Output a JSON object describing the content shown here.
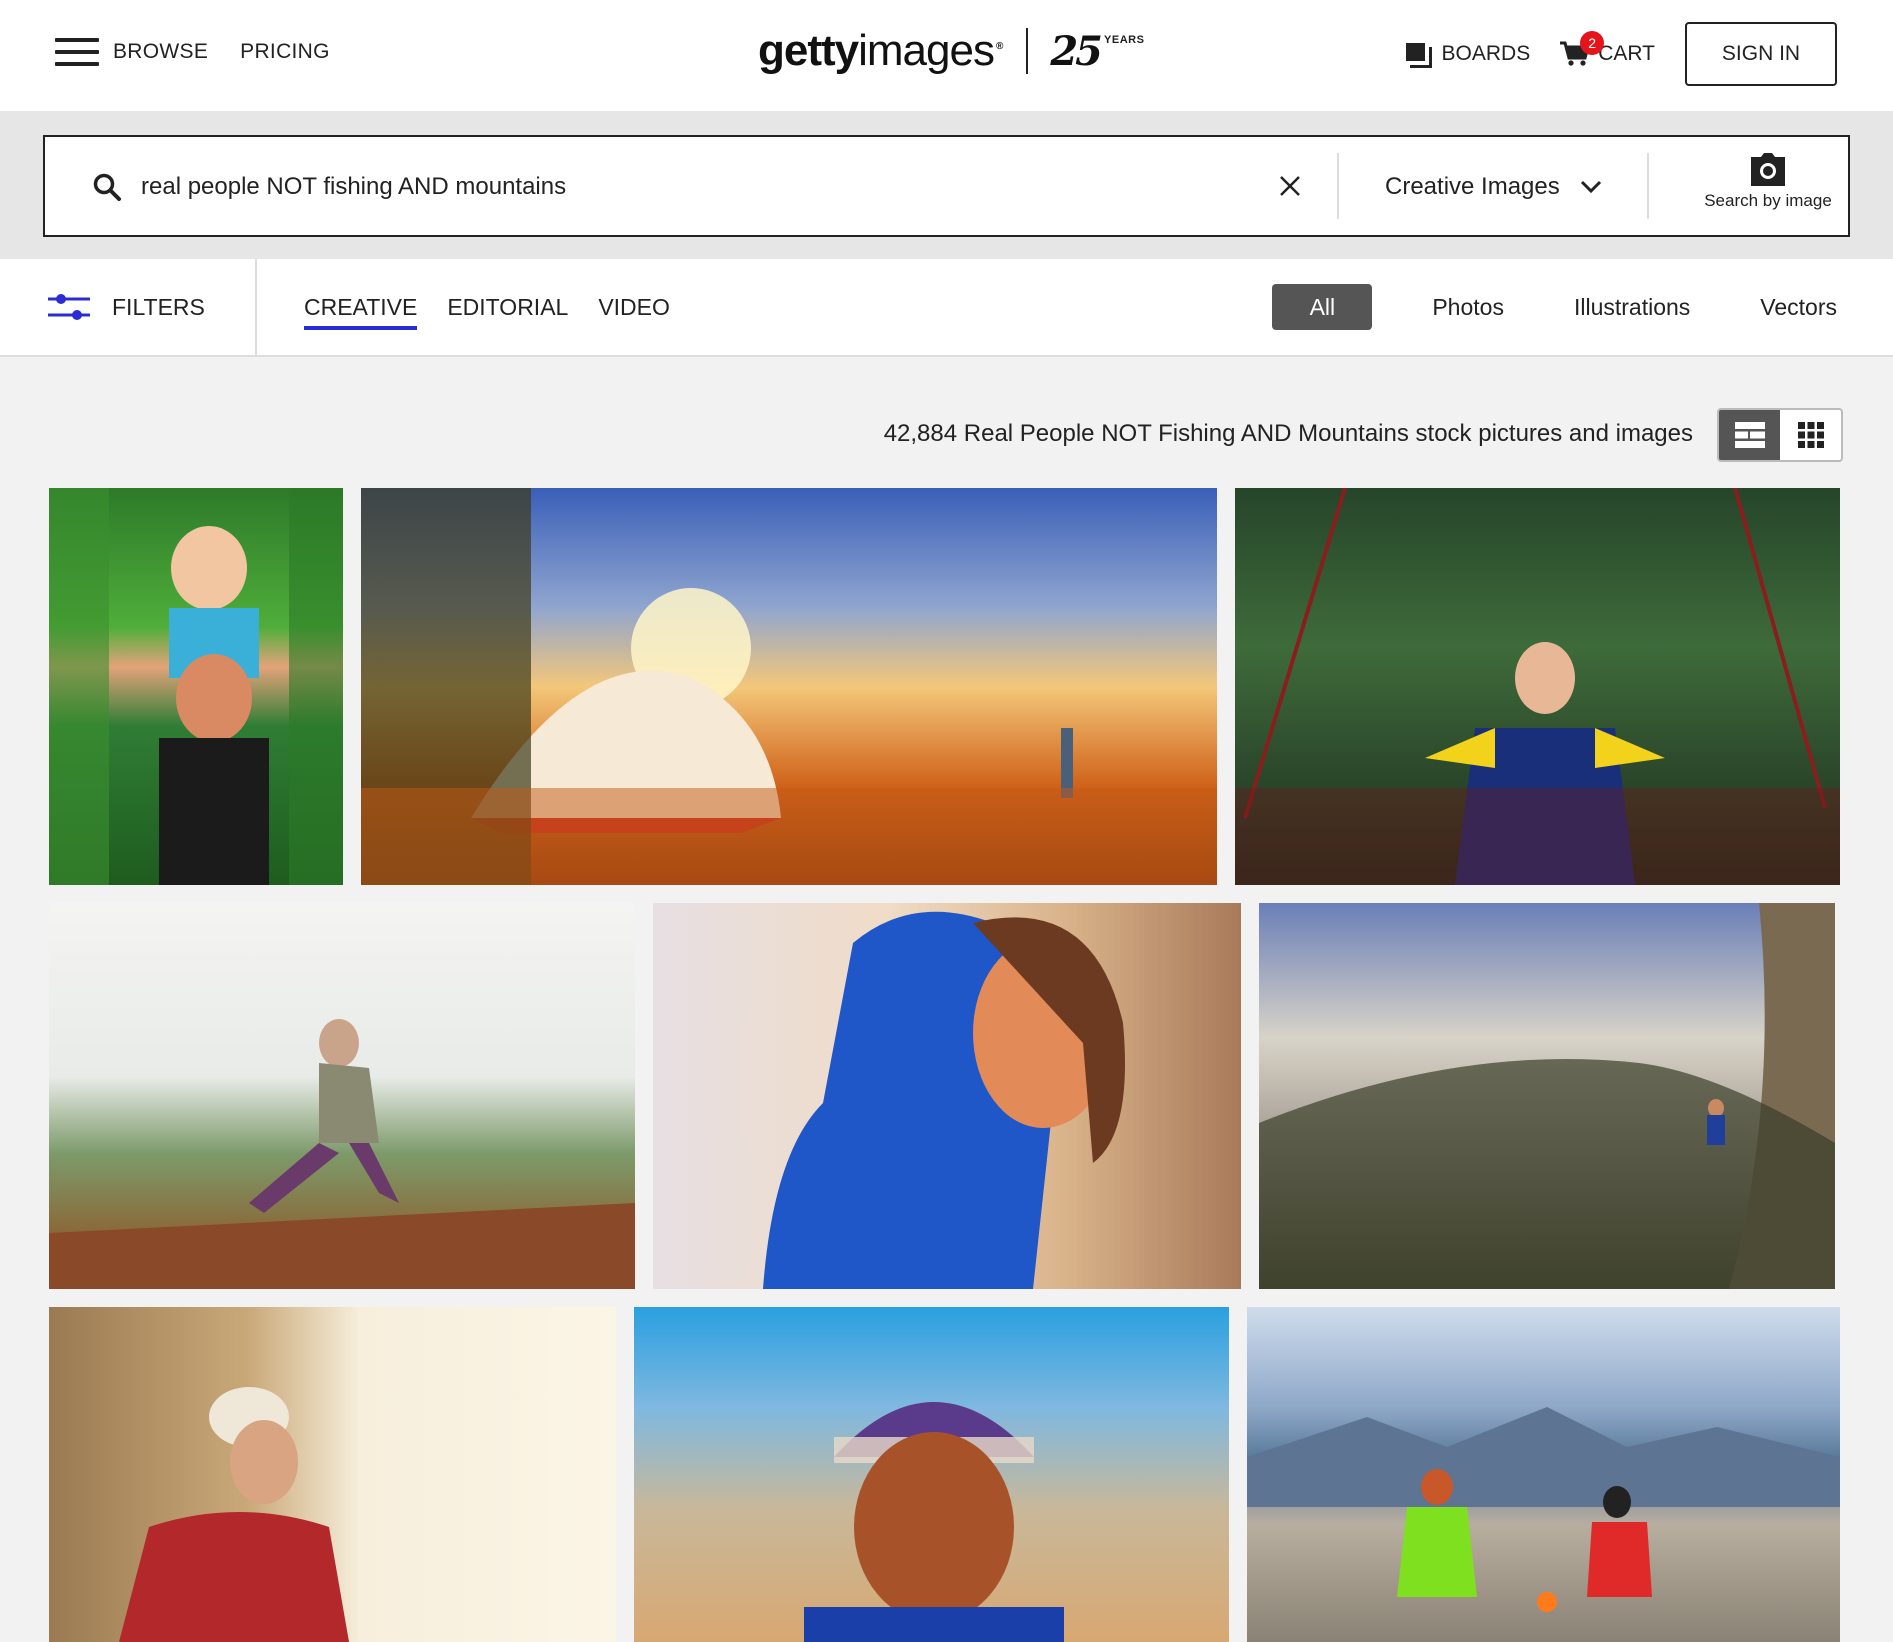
{
  "nav": {
    "browse": "BROWSE",
    "pricing": "PRICING",
    "logo_bold": "getty",
    "logo_thin": "images",
    "logo_reg": "®",
    "logo_25": "25",
    "logo_years": "YEARS",
    "boards": "BOARDS",
    "cart": "CART",
    "cart_count": "2",
    "sign_in": "SIGN IN"
  },
  "search": {
    "query": "real people NOT fishing AND mountains",
    "scope": "Creative Images",
    "image_search_label": "Search by image"
  },
  "filterbar": {
    "filters_label": "FILTERS",
    "content_tabs": [
      "CREATIVE",
      "EDITORIAL",
      "VIDEO"
    ],
    "active_content_tab": "CREATIVE",
    "type_tabs": [
      "All",
      "Photos",
      "Illustrations",
      "Vectors"
    ],
    "active_type_tab": "All"
  },
  "results": {
    "count_text": "42,884 Real People NOT Fishing AND Mountains stock pictures and images"
  },
  "colors": {
    "accent": "#2c2cd6",
    "cart_badge": "#e5141a",
    "active_tab_bg": "#555555"
  },
  "images": [
    {
      "id": "dad-child-jungle"
    },
    {
      "id": "tent-sunset-camp"
    },
    {
      "id": "woman-rope-bridge"
    },
    {
      "id": "hiker-leaping-rocks"
    },
    {
      "id": "woman-blue-hood"
    },
    {
      "id": "climber-cliff-mist"
    },
    {
      "id": "climber-helmet-rock"
    },
    {
      "id": "man-knit-hat"
    },
    {
      "id": "two-hikers-summit"
    }
  ]
}
